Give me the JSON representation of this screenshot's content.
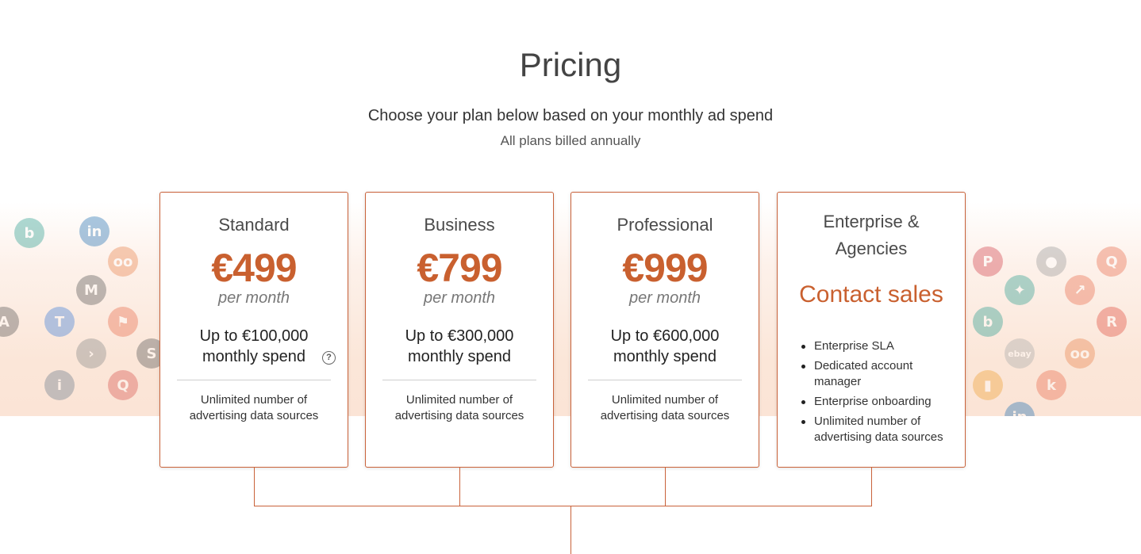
{
  "header": {
    "title": "Pricing",
    "subtitle": "Choose your plan below based on your monthly ad spend",
    "billing_note": "All plans billed annually"
  },
  "plans": [
    {
      "name": "Standard",
      "price": "€499",
      "period": "per month",
      "spend_line1": "Up to €100,000",
      "spend_line2": "monthly spend",
      "feature_line1": "Unlimited number of",
      "feature_line2": "advertising data sources"
    },
    {
      "name": "Business",
      "price": "€799",
      "period": "per month",
      "spend_line1": "Up to €300,000",
      "spend_line2": "monthly spend",
      "feature_line1": "Unlimited number of",
      "feature_line2": "advertising data sources"
    },
    {
      "name": "Professional",
      "price": "€999",
      "period": "per month",
      "spend_line1": "Up to €600,000",
      "spend_line2": "monthly spend",
      "feature_line1": "Unlimited number of",
      "feature_line2": "advertising data sources"
    }
  ],
  "enterprise": {
    "name_line1": "Enterprise &",
    "name_line2": "Agencies",
    "cta": "Contact sales",
    "features": [
      "Enterprise SLA",
      "Dedicated account manager",
      "Enterprise onboarding",
      "Unlimited number of advertising data sources"
    ]
  },
  "help_icon_glyph": "?",
  "icons": {
    "help": "question-circle-icon",
    "background": "integration-logos-pattern"
  },
  "colors": {
    "accent": "#c9602f",
    "card_border": "#c9623a",
    "band": "#fbe6d8"
  }
}
